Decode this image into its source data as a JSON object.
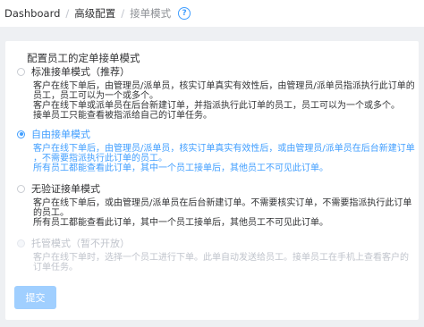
{
  "breadcrumb": {
    "items": [
      "Dashboard",
      "高级配置",
      "接单模式"
    ],
    "separator": "/"
  },
  "icons": {
    "help": "question-circle-icon"
  },
  "section": {
    "title": "配置员工的定单接单模式"
  },
  "options": [
    {
      "label": "标准接单模式（推荐）",
      "state": "unchecked",
      "lines": [
        "客户在线下单后，由管理员/派单员，核实订单真实有效性后，由管理员/派单员指派执行此订单的",
        "员工，员工可以为一个或多个。",
        "客户在线下单或派单员在后台新建订单，并指派执行此订单的员工，员工可以为一个或多个。",
        "接单员工只能查看被指派给自己的订单任务。"
      ]
    },
    {
      "label": "自由接单模式",
      "state": "checked",
      "lines": [
        "客户在线下单后，由管理员/派单员，核实订单真实有效性后，或由管理员/派单员在后台新建订单",
        "，不需要指派执行此订单的员工。",
        "所有员工都能查看此订单，其中一个员工接单后，其他员工不可见此订单。"
      ]
    },
    {
      "label": "无验证接单模式",
      "state": "unchecked",
      "lines": [
        "客户在线下单后，或由管理员/派单员在后台新建订单。不需要核实订单，不需要指派执行此订单",
        "的员工。",
        "所有员工都能查看此订单，其中一个员工接单后，其他员工不可见此订单。"
      ]
    },
    {
      "label": "托管模式（暂不开放）",
      "state": "disabled",
      "lines": [
        "客户在线下单时，选择一个员工进行下单。此单自动发送给员工。接单员工在手机上查看客户的",
        "订单任务。"
      ]
    }
  ],
  "submit_label": "提交",
  "colors": {
    "accent": "#409eff",
    "disabled_text": "#c0c4cc",
    "submit_bg": "#a0cfff",
    "page_bg": "#eef0f3"
  }
}
